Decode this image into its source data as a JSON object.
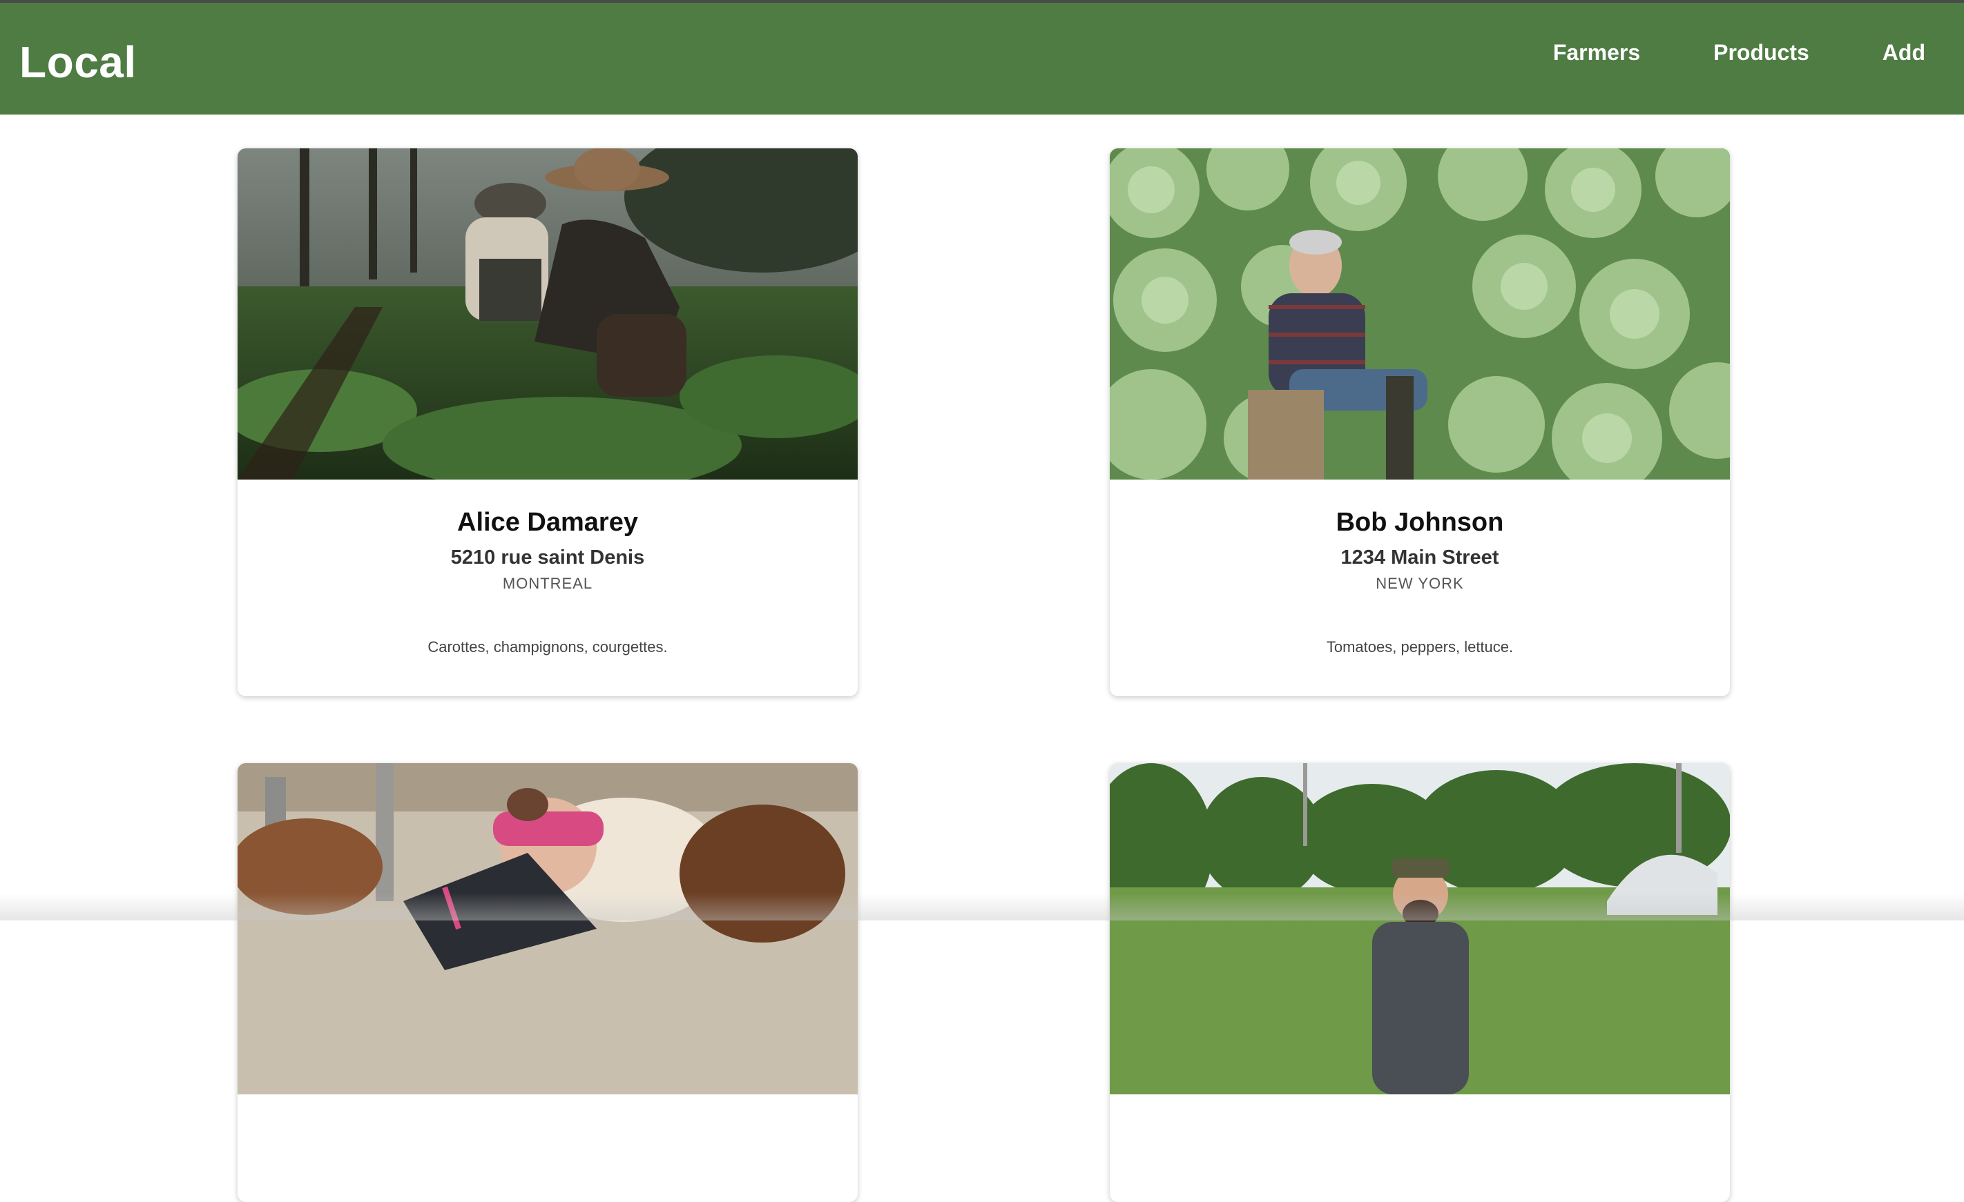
{
  "header": {
    "brand": "Local",
    "nav": [
      {
        "label": "Farmers"
      },
      {
        "label": "Products"
      },
      {
        "label": "Add"
      }
    ]
  },
  "farmers": [
    {
      "name": "Alice Damarey",
      "address": "5210 rue saint Denis",
      "city": "MONTREAL",
      "products": "Carottes, champignons, courgettes."
    },
    {
      "name": "Bob Johnson",
      "address": "1234 Main Street",
      "city": "NEW YORK",
      "products": "Tomatoes, peppers, lettuce."
    },
    {
      "name": "",
      "address": "",
      "city": "",
      "products": ""
    },
    {
      "name": "",
      "address": "",
      "city": "",
      "products": ""
    }
  ],
  "colors": {
    "header_bg": "#4e7c43",
    "header_text": "#ffffff"
  }
}
